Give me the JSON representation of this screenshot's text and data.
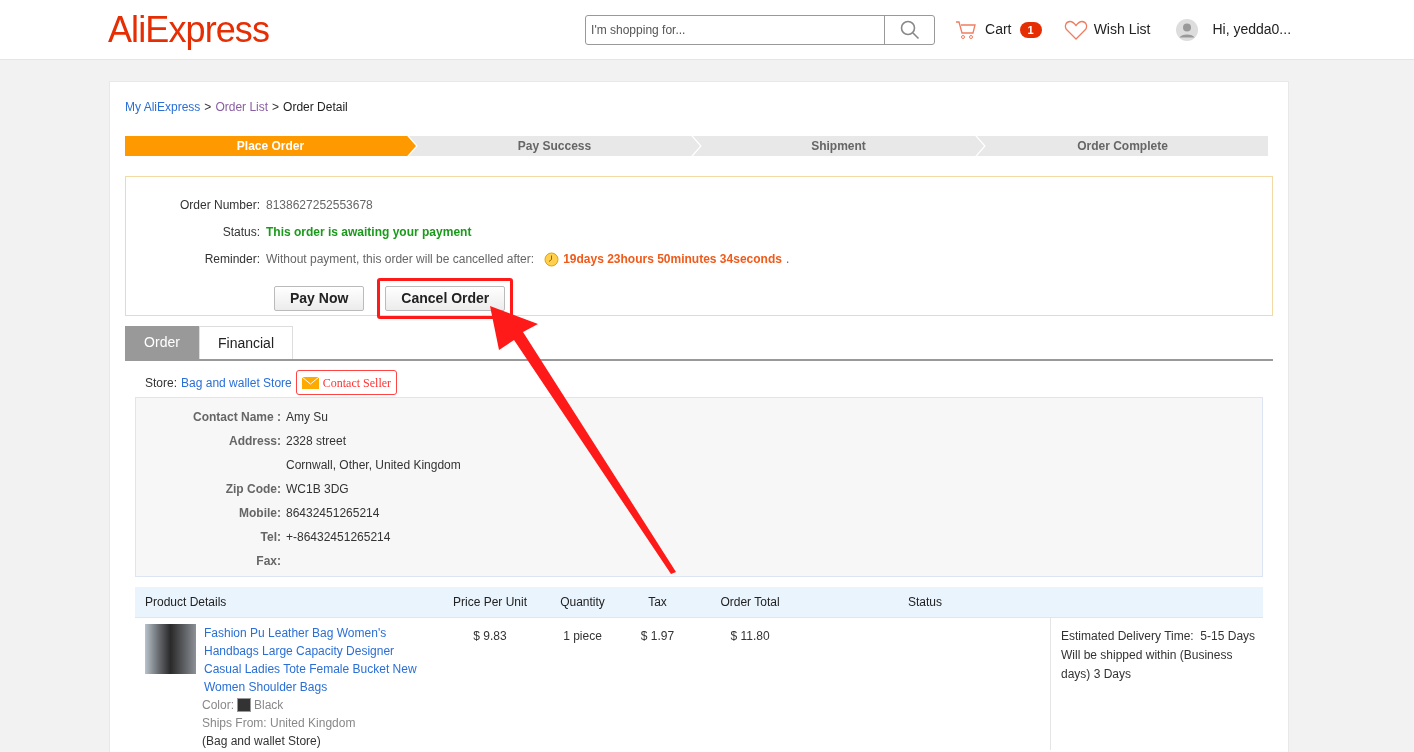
{
  "header": {
    "logo": "AliExpress",
    "search": {
      "placeholder": "I'm shopping for..."
    },
    "cart": {
      "label": "Cart",
      "count": "1"
    },
    "wish_list": "Wish List",
    "user": "Hi, yedda0..."
  },
  "breadcrumb": [
    {
      "label": "My AliExpress",
      "kind": "link"
    },
    {
      "label": ">",
      "kind": "separator"
    },
    {
      "label": "Order List",
      "kind": "visited"
    },
    {
      "label": ">",
      "kind": "separator"
    },
    {
      "label": "Order Detail",
      "kind": "current"
    }
  ],
  "steps": [
    {
      "label": "Place Order",
      "selected": true
    },
    {
      "label": "Pay Success",
      "selected": false
    },
    {
      "label": "Shipment",
      "selected": false
    },
    {
      "label": "Order Complete",
      "selected": false
    }
  ],
  "order_info": {
    "number_label": "Order Number:",
    "number": "8138627252553678",
    "status_label": "Status:",
    "status": "This order is awaiting your payment",
    "reminder_label": "Reminder:",
    "reminder": "Without payment, this order will be cancelled after:",
    "countdown": "19days 23hours 50minutes 34seconds",
    "countdown_end": ".",
    "buttons": [
      {
        "label": "Pay Now",
        "highlighted": false
      },
      {
        "label": "Cancel Order",
        "highlighted": true
      }
    ]
  },
  "tabs": [
    {
      "label": "Order",
      "selected": true
    },
    {
      "label": "Financial",
      "selected": false
    }
  ],
  "store": {
    "label": "Store:",
    "name": "Bag and wallet Store",
    "contact": "Contact Seller"
  },
  "contact_fields": [
    {
      "label": "Contact Name :",
      "value": "Amy Su"
    },
    {
      "label": "Address:",
      "value": "2328 street"
    },
    {
      "value": "Cornwall, Other, United Kingdom"
    },
    {
      "label": "Zip Code:",
      "value": "WC1B 3DG"
    },
    {
      "label": "Mobile:",
      "value": "86432451265214"
    },
    {
      "label": "Tel:",
      "value": "+-86432451265214"
    },
    {
      "label": "Fax:"
    }
  ],
  "table": {
    "columns": [
      "Product Details",
      "Price Per Unit",
      "Quantity",
      "Tax",
      "Order Total",
      "Status"
    ],
    "rows": [
      {
        "title": "Fashion Pu Leather Bag Women's Handbags Large Capacity Designer Casual Ladies Tote Female Bucket New Women Shoulder Bags",
        "color_label": "Color:",
        "color_name": "Black",
        "ships_from": "Ships From: United Kingdom",
        "store": "(Bag and wallet Store)",
        "price": "$ 9.83",
        "quantity": "1 piece",
        "tax": "$ 1.97",
        "total": "$ 11.80",
        "delivery": "Estimated Delivery Time:  5-15 Days",
        "shipping": "Will be shipped within (Business days) 3 Days"
      }
    ]
  }
}
